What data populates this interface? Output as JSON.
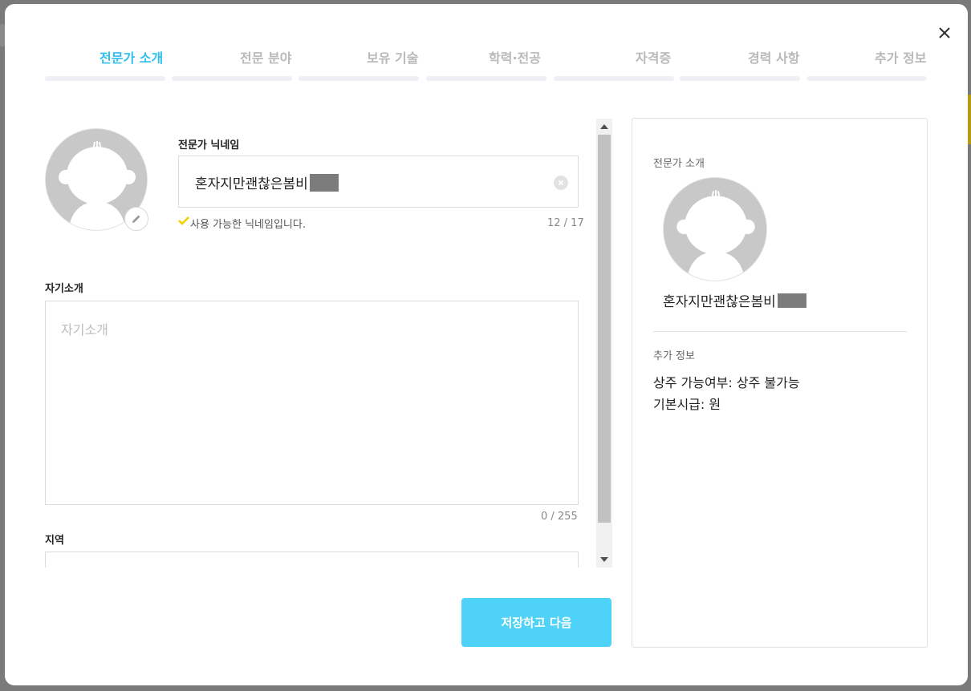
{
  "tabs": [
    {
      "label": "전문가 소개",
      "active": true
    },
    {
      "label": "전문 분야"
    },
    {
      "label": "보유 기술"
    },
    {
      "label": "학력·전공"
    },
    {
      "label": "자격증"
    },
    {
      "label": "경력 사항"
    },
    {
      "label": "추가 정보"
    }
  ],
  "form": {
    "nickname_label": "전문가 닉네임",
    "nickname_value": "혼자지만괜찮은봄비",
    "nickname_status": "사용 가능한 닉네임입니다.",
    "nickname_counter": "12 / 17",
    "intro_label": "자기소개",
    "intro_placeholder": "자기소개",
    "intro_counter": "0 / 255",
    "region_label": "지역"
  },
  "buttons": {
    "save_next": "저장하고 다음"
  },
  "preview": {
    "section_intro": "전문가 소개",
    "nickname": "혼자지만괜찮은봄비",
    "section_extra": "추가 정보",
    "resident_line": "상주 가능여부: 상주 불가능",
    "salary_line": "기본시급: 원"
  },
  "colors": {
    "accent": "#2ec0ee",
    "button": "#4fd2f8",
    "check": "#f5d000",
    "tab_inactive": "#b9b9b9"
  }
}
